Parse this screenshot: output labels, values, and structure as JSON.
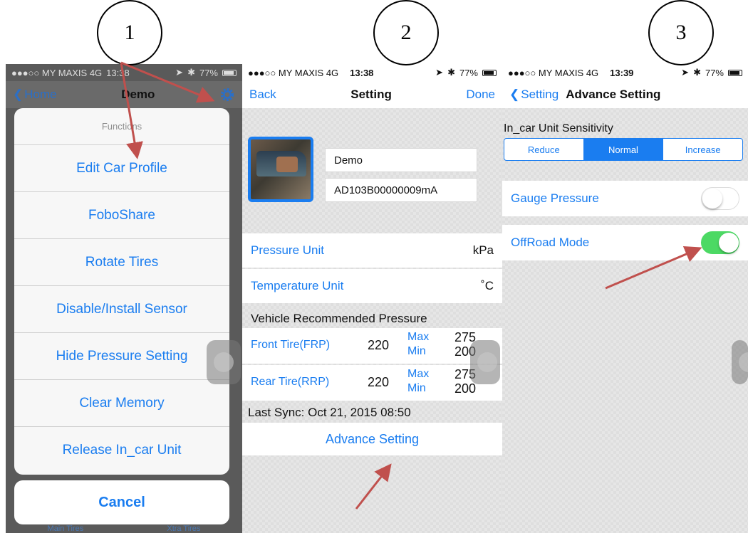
{
  "colors": {
    "accent": "#1a7df0",
    "arrow": "#c0504d",
    "switch_on": "#4cd964"
  },
  "steps": [
    "1",
    "2",
    "3"
  ],
  "phone1": {
    "status": {
      "carrier": "●●●○○ MY MAXIS  4G",
      "time": "13:38",
      "battery": "77%"
    },
    "nav": {
      "back": "Home",
      "title": "Demo",
      "settings_icon": "gear-icon"
    },
    "sheet_title": "Functions",
    "items": [
      "Edit Car Profile",
      "FoboShare",
      "Rotate Tires",
      "Disable/Install Sensor",
      "Hide Pressure Setting",
      "Clear Memory",
      "Release In_car Unit"
    ],
    "cancel": "Cancel",
    "tabs": [
      "Main Tires",
      "Xtra Tires"
    ]
  },
  "phone2": {
    "status": {
      "carrier": "●●●○○ MY MAXIS  4G",
      "time": "13:38",
      "battery": "77%"
    },
    "nav": {
      "back": "Back",
      "title": "Setting",
      "done": "Done"
    },
    "car_name": "Demo",
    "device_id": "AD103B00000009mA",
    "pressure_unit": {
      "label": "Pressure Unit",
      "value": "kPa"
    },
    "temperature_unit": {
      "label": "Temperature Unit",
      "value": "˚C"
    },
    "recommended_label": "Vehicle Recommended Pressure",
    "front": {
      "label": "Front Tire(FRP)",
      "value": "220",
      "max_label": "Max",
      "max": "275",
      "min_label": "Min",
      "min": "200"
    },
    "rear": {
      "label": "Rear Tire(RRP)",
      "value": "220",
      "max_label": "Max",
      "max": "275",
      "min_label": "Min",
      "min": "200"
    },
    "last_sync": "Last Sync:  Oct 21, 2015  08:50",
    "advance": "Advance Setting"
  },
  "phone3": {
    "status": {
      "carrier": "●●●○○ MY MAXIS  4G",
      "time": "13:39",
      "battery": "77%"
    },
    "nav": {
      "back": "Setting",
      "title": "Advance Setting"
    },
    "sensitivity_label": "In_car Unit Sensitivity",
    "segments": [
      "Reduce",
      "Normal",
      "Increase"
    ],
    "selected_segment": "Normal",
    "gauge_pressure": {
      "label": "Gauge Pressure",
      "on": false
    },
    "offroad": {
      "label": "OffRoad Mode",
      "on": true
    }
  }
}
